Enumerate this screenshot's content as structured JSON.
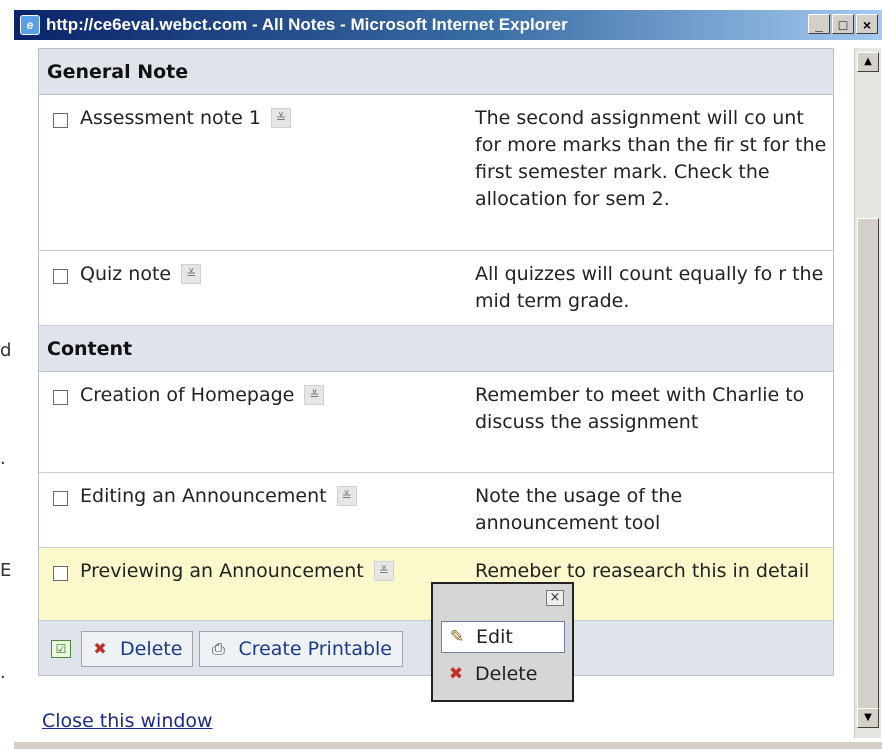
{
  "window": {
    "title": "http://ce6eval.webct.com - All Notes - Microsoft Internet Explorer",
    "minimize": "_",
    "maximize": "□",
    "close": "×"
  },
  "sections": [
    {
      "heading": "General Note",
      "notes": [
        {
          "title": "Assessment note 1",
          "note": "The second assignment will co unt for more marks than the fir st for the first semester mark. Check the allocation for sem 2."
        },
        {
          "title": "Quiz note",
          "note": "All quizzes will count equally fo r the mid term grade."
        }
      ]
    },
    {
      "heading": "Content",
      "notes": [
        {
          "title": "Creation of Homepage",
          "note": "Remember to meet with Charlie to discuss the assignment"
        },
        {
          "title": "Editing an Announcement",
          "note": "Note the usage of the announcement tool"
        },
        {
          "title": "Previewing an Announcement",
          "note": "Remeber to reasearch this in detail"
        }
      ]
    }
  ],
  "footer": {
    "delete_label": "Delete",
    "printable_label": "Create Printable"
  },
  "popup": {
    "edit_label": "Edit",
    "delete_label": "Delete"
  },
  "close_link": "Close this window",
  "icons": {
    "menu": "action-menu-icon",
    "checkall": "check-all-icon",
    "delete": "delete-x-icon",
    "print": "printer-icon",
    "edit": "pencil-icon"
  },
  "colors": {
    "section_bg": "#dfe4ec",
    "highlight_row": "#fbf8cc",
    "link": "#1a3a8a"
  }
}
